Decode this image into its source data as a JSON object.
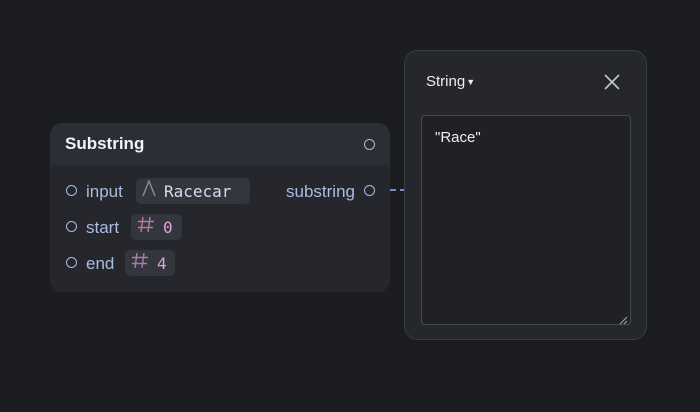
{
  "node": {
    "title": "Substring",
    "inputs": [
      {
        "label": "input",
        "type_icon": "text-type-icon",
        "value": "Racecar"
      },
      {
        "label": "start",
        "type_icon": "number-type-icon",
        "value": "0"
      },
      {
        "label": "end",
        "type_icon": "number-type-icon",
        "value": "4"
      }
    ],
    "output": {
      "label": "substring"
    }
  },
  "popover": {
    "type_label": "String",
    "value": "\"Race\""
  },
  "colors": {
    "background": "#1b1d21",
    "node_bg": "#25272d",
    "port": "#a9bde0",
    "link": "#6d8fc6",
    "number_value": "#e6a1d8"
  }
}
